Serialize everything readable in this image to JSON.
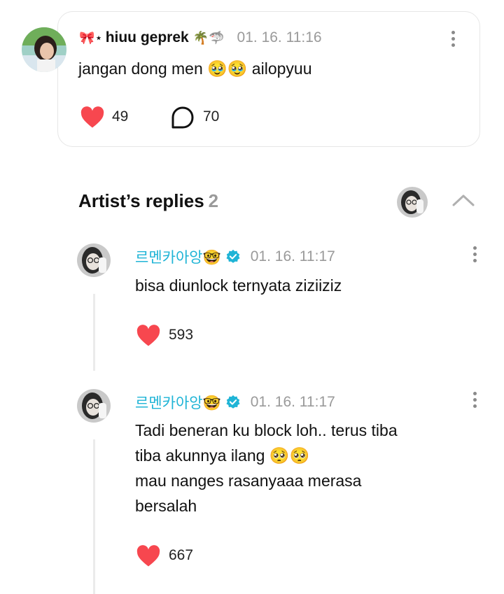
{
  "main_comment": {
    "username_prefix_emoji": "🎀⋆",
    "username": "hiuu geprek",
    "username_suffix_emoji": "🌴🦈",
    "timestamp": "01. 16. 11:16",
    "text": "jangan dong men 🥹🥹 ailopyuu",
    "likes": "49",
    "replies": "70"
  },
  "artist_replies": {
    "title": "Artist’s replies",
    "count": "2"
  },
  "replies": [
    {
      "author": "르멘카아앙🤓",
      "timestamp": "01. 16. 11:17",
      "lines": [
        "bisa diunlock ternyata ziziiziz"
      ],
      "likes": "593"
    },
    {
      "author": "르멘카아앙🤓",
      "timestamp": "01. 16. 11:17",
      "lines": [
        "Tadi beneran ku block loh.. terus tiba",
        "tiba akunnya ilang 🥺🥺",
        "mau nanges rasanyaaa merasa",
        "bersalah"
      ],
      "likes": "667"
    }
  ],
  "colors": {
    "heart": "#f7474f",
    "artist_name": "#1fb4d6",
    "verified_badge": "#1fb4d6",
    "muted_text": "#9a9a9a"
  },
  "icons": {
    "like": "heart-icon",
    "reply": "speech-bubble-icon",
    "more": "kebab-menu-icon",
    "collapse": "chevron-up-icon",
    "verified": "verified-badge-icon"
  }
}
